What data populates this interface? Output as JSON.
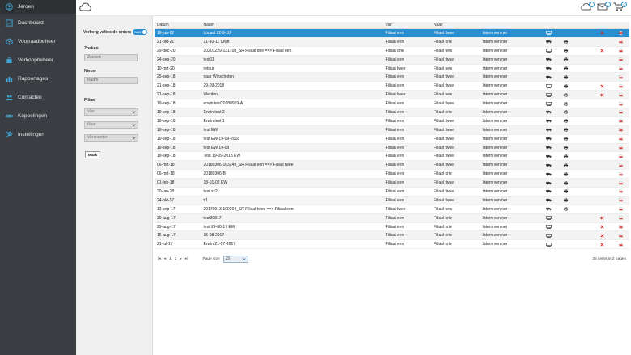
{
  "sidebar": {
    "user": "Jeroen",
    "items": [
      {
        "label": "Dashboard",
        "icon": "dashboard-icon"
      },
      {
        "label": "Voorraadbeheer",
        "icon": "cube-icon"
      },
      {
        "label": "Verkoopbeheer",
        "icon": "bag-icon"
      },
      {
        "label": "Rapportages",
        "icon": "chart-icon"
      },
      {
        "label": "Contacten",
        "icon": "people-icon"
      },
      {
        "label": "Koppelingen",
        "icon": "link-icon"
      },
      {
        "label": "Instellingen",
        "icon": "wrench-icon"
      }
    ]
  },
  "topbar": {
    "cart_count": "0"
  },
  "filters": {
    "hide_label": "Verberg voltooide orders",
    "toggle_label": "AAN",
    "search_label": "Zoeken",
    "search_placeholder": "Zoeken",
    "new_label": "Nieuw",
    "new_placeholder": "Naam",
    "filiaal_label": "Filiaal",
    "van_placeholder": "Van",
    "naar_placeholder": "Naar",
    "vervoerder_placeholder": "Vervoerder",
    "search_button": "Maak"
  },
  "grid": {
    "headers": {
      "datum": "Datum",
      "naam": "Naam",
      "van": "Van",
      "naar": "Naar"
    },
    "rows": [
      {
        "datum": "19-jun-22",
        "naam": "Locaal 22-6-10",
        "van": "Filiaal een",
        "naar": "Filiaal twee",
        "vervoer": "Intern vervoer",
        "i1": "doc",
        "i2": "",
        "i3": "",
        "i4": "x",
        "i5": "pdf",
        "sel": true
      },
      {
        "datum": "21-okt-21",
        "naam": "21-10-11 Ciwlt",
        "van": "Filiaal een",
        "naar": "Filiaal drie",
        "vervoer": "Intern vervoer",
        "i1": "truck",
        "i2": "print",
        "i3": "",
        "i4": "",
        "i5": "pdf"
      },
      {
        "datum": "29-dec-20",
        "naam": "20201229-131708_SR Filiaal drie ==> Filiaal een",
        "van": "Filiaal drie",
        "naar": "Filiaal een",
        "vervoer": "Intern vervoer",
        "i1": "doc",
        "i2": "print",
        "i3": "",
        "i4": "x",
        "i5": "pdf"
      },
      {
        "datum": "24-sep-20",
        "naam": "test11",
        "van": "Filiaal een",
        "naar": "Filiaal twee",
        "vervoer": "Intern vervoer",
        "i1": "truck",
        "i2": "print",
        "i3": "",
        "i4": "",
        "i5": "pdf"
      },
      {
        "datum": "10-mrt-20",
        "naam": "retour",
        "van": "Filiaal twee",
        "naar": "Filiaal een",
        "vervoer": "Intern vervoer",
        "i1": "truck",
        "i2": "print",
        "i3": "",
        "i4": "",
        "i5": "pdf"
      },
      {
        "datum": "25-sep-18",
        "naam": "naar Winschoten",
        "van": "Filiaal een",
        "naar": "Filiaal twee",
        "vervoer": "Intern vervoer",
        "i1": "truck",
        "i2": "print",
        "i3": "",
        "i4": "",
        "i5": "pdf"
      },
      {
        "datum": "21-sep-18",
        "naam": "29-09-2018",
        "van": "Filiaal een",
        "naar": "Filiaal twee",
        "vervoer": "Intern vervoer",
        "i1": "doc",
        "i2": "print",
        "i3": "",
        "i4": "x",
        "i5": "pdf"
      },
      {
        "datum": "21-sep-18",
        "naam": "Werden",
        "van": "Filiaal twee",
        "naar": "Filiaal een",
        "vervoer": "Intern vervoer",
        "i1": "doc",
        "i2": "print",
        "i3": "",
        "i4": "x",
        "i5": "pdf"
      },
      {
        "datum": "19-sep-18",
        "naam": "erwin test20180919-A",
        "van": "Filiaal een",
        "naar": "Filiaal twee",
        "vervoer": "Intern vervoer",
        "i1": "doc",
        "i2": "print",
        "i3": "",
        "i4": "",
        "i5": "pdf"
      },
      {
        "datum": "19-sep-18",
        "naam": "Erwin test 2",
        "van": "Filiaal een",
        "naar": "Filiaal drie",
        "vervoer": "Intern vervoer",
        "i1": "truck",
        "i2": "print",
        "i3": "",
        "i4": "",
        "i5": "pdf"
      },
      {
        "datum": "19-sep-18",
        "naam": "Erwin test 1",
        "van": "Filiaal een",
        "naar": "Filiaal twee",
        "vervoer": "Intern vervoer",
        "i1": "truck",
        "i2": "print",
        "i3": "",
        "i4": "",
        "i5": "pdf"
      },
      {
        "datum": "19-sep-18",
        "naam": "test EW",
        "van": "Filiaal een",
        "naar": "Filiaal twee",
        "vervoer": "Intern vervoer",
        "i1": "truck",
        "i2": "print",
        "i3": "",
        "i4": "",
        "i5": "pdf"
      },
      {
        "datum": "19-sep-18",
        "naam": "test EW 19-09-2018",
        "van": "Filiaal een",
        "naar": "Filiaal twee",
        "vervoer": "Intern vervoer",
        "i1": "truck",
        "i2": "print",
        "i3": "",
        "i4": "",
        "i5": "pdf"
      },
      {
        "datum": "19-sep-18",
        "naam": "test EW 19-09",
        "van": "Filiaal een",
        "naar": "Filiaal twee",
        "vervoer": "Intern vervoer",
        "i1": "truck",
        "i2": "print",
        "i3": "",
        "i4": "",
        "i5": "pdf"
      },
      {
        "datum": "19-sep-18",
        "naam": "Test 19-09-2018 EW",
        "van": "Filiaal een",
        "naar": "Filiaal twee",
        "vervoer": "Intern vervoer",
        "i1": "truck",
        "i2": "print",
        "i3": "",
        "i4": "",
        "i5": "pdf"
      },
      {
        "datum": "06-mrt-18",
        "naam": "20180306-163249_SR Filiaal een ==> Filiaal twee",
        "van": "Filiaal een",
        "naar": "Filiaal twee",
        "vervoer": "Intern vervoer",
        "i1": "truck",
        "i2": "print",
        "i3": "",
        "i4": "",
        "i5": "pdf"
      },
      {
        "datum": "06-mrt-18",
        "naam": "20180306-B",
        "van": "Filiaal een",
        "naar": "Filiaal drie",
        "vervoer": "Intern vervoer",
        "i1": "truck",
        "i2": "print",
        "i3": "",
        "i4": "",
        "i5": "pdf"
      },
      {
        "datum": "01-feb-18",
        "naam": "18-01-02 EW",
        "van": "Filiaal een",
        "naar": "Filiaal twee",
        "vervoer": "Intern vervoer",
        "i1": "truck",
        "i2": "print",
        "i3": "",
        "i4": "",
        "i5": "pdf"
      },
      {
        "datum": "30-jan-18",
        "naam": "test xx2",
        "van": "Filiaal een",
        "naar": "Filiaal twee",
        "vervoer": "Intern vervoer",
        "i1": "truck",
        "i2": "print",
        "i3": "",
        "i4": "",
        "i5": "pdf"
      },
      {
        "datum": "24-okt-17",
        "naam": "tt1",
        "van": "Filiaal een",
        "naar": "Filiaal twee",
        "vervoer": "Intern vervoer",
        "i1": "truck",
        "i2": "print",
        "i3": "",
        "i4": "",
        "i5": "pdf"
      },
      {
        "datum": "13-sep-17",
        "naam": "20170913-100304_SR Filiaal twee ==> Filiaal een",
        "van": "Filiaal twee",
        "naar": "Filiaal een",
        "vervoer": "Intern vervoer",
        "i1": "truck",
        "i2": "print",
        "i3": "",
        "i4": "",
        "i5": "pdf"
      },
      {
        "datum": "30-aug-17",
        "naam": "test30817",
        "van": "Filiaal een",
        "naar": "Filiaal drie",
        "vervoer": "Intern vervoer",
        "i1": "doc",
        "i2": "",
        "i3": "",
        "i4": "x",
        "i5": "pdf"
      },
      {
        "datum": "29-aug-17",
        "naam": "test 29-08-17 EW",
        "van": "Filiaal een",
        "naar": "Filiaal drie",
        "vervoer": "Intern vervoer",
        "i1": "doc",
        "i2": "",
        "i3": "",
        "i4": "x",
        "i5": "pdf"
      },
      {
        "datum": "15-aug-17",
        "naam": "15-08-2017",
        "van": "Filiaal een",
        "naar": "Filiaal drie",
        "vervoer": "Intern vervoer",
        "i1": "doc",
        "i2": "",
        "i3": "",
        "i4": "x",
        "i5": "pdf"
      },
      {
        "datum": "21-jul-17",
        "naam": "Erwin 21-07-2017",
        "van": "Filiaal een",
        "naar": "Filiaal drie",
        "vervoer": "Intern vervoer",
        "i1": "doc",
        "i2": "",
        "i3": "",
        "i4": "x",
        "i5": "pdf"
      }
    ]
  },
  "pager": {
    "page1": "1",
    "page2": "2",
    "size_label": "Page size",
    "size_value": "25",
    "items_info": "35 items in 2 pages"
  },
  "colors": {
    "accent": "#2a8fd0",
    "sidebar": "#3a3d41",
    "delete": "#d32020"
  }
}
